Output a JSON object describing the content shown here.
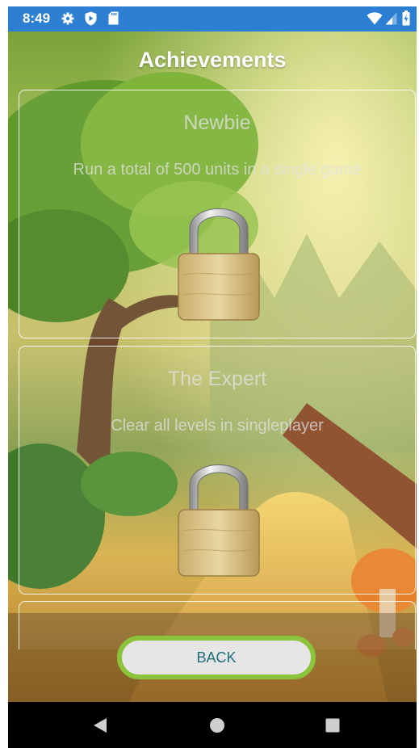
{
  "status_bar": {
    "time": "8:49",
    "left_icons": [
      "gear-icon",
      "play-protect-icon",
      "sd-card-icon"
    ],
    "right_icons": [
      "wifi-icon",
      "cell-signal-icon",
      "battery-icon"
    ],
    "background": "#2d7fd3"
  },
  "header": {
    "title": "Achievements"
  },
  "achievements": [
    {
      "title": "Newbie",
      "description": "Run a total of 500 units in a single game",
      "locked": true,
      "icon": "lock-icon"
    },
    {
      "title": "The Expert",
      "description": "Clear all levels in singleplayer",
      "locked": true,
      "icon": "lock-icon"
    }
  ],
  "back_button": {
    "label": "BACK",
    "border_color": "#8bc43a",
    "text_color": "#1b6f7a"
  },
  "nav_bar": {
    "buttons": [
      "back-icon",
      "home-icon",
      "recents-icon"
    ]
  }
}
